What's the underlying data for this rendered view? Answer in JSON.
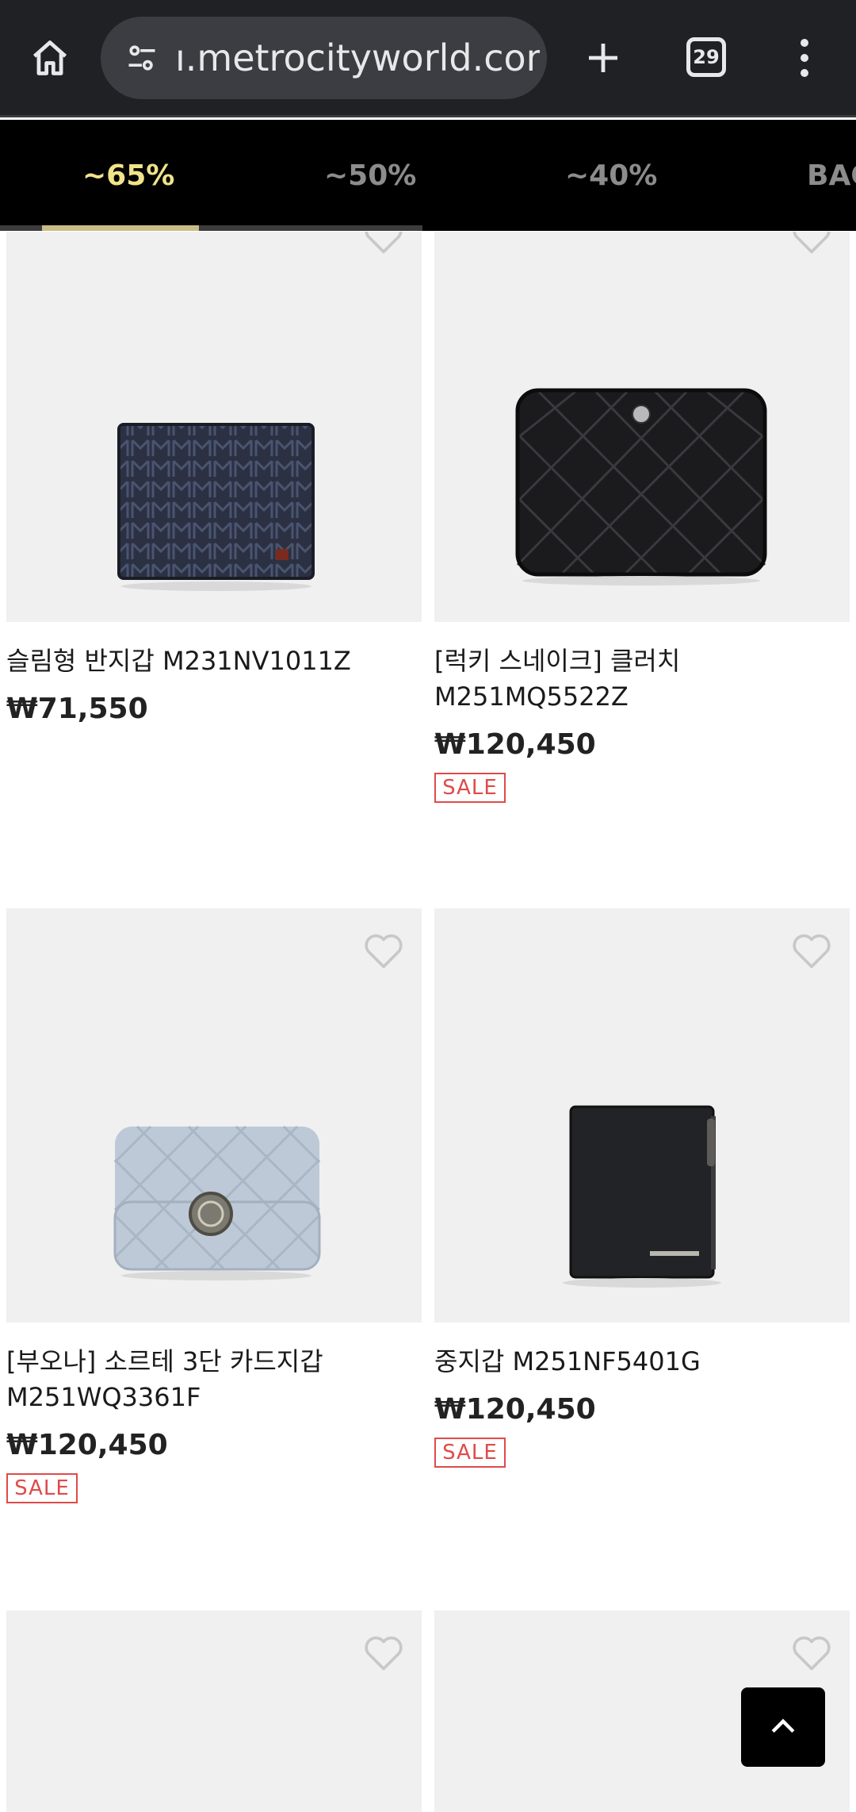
{
  "browser": {
    "url": "ı.metrocityworld.com",
    "tab_count": "29"
  },
  "discount_tabs": [
    {
      "label": "~65%",
      "active": true
    },
    {
      "label": "~50%",
      "active": false
    },
    {
      "label": "~40%",
      "active": false
    },
    {
      "label": "BAG",
      "active": false
    }
  ],
  "products": [
    {
      "name": "슬림형 반지갑 M231NV1011Z",
      "price": "₩71,550",
      "sale": false
    },
    {
      "name": "[럭키 스네이크] 클러치 M251MQ5522Z",
      "price": "₩120,450",
      "sale": true,
      "sale_label": "SALE"
    },
    {
      "name": "[부오나] 소르테 3단 카드지갑 M251WQ3361F",
      "price": "₩120,450",
      "sale": true,
      "sale_label": "SALE"
    },
    {
      "name": "중지갑 M251NF5401G",
      "price": "₩120,450",
      "sale": true,
      "sale_label": "SALE"
    }
  ],
  "colors": {
    "active_tab": "#f1e38a",
    "sale_red": "#e04a4a",
    "chrome_bg": "#1f2124"
  }
}
